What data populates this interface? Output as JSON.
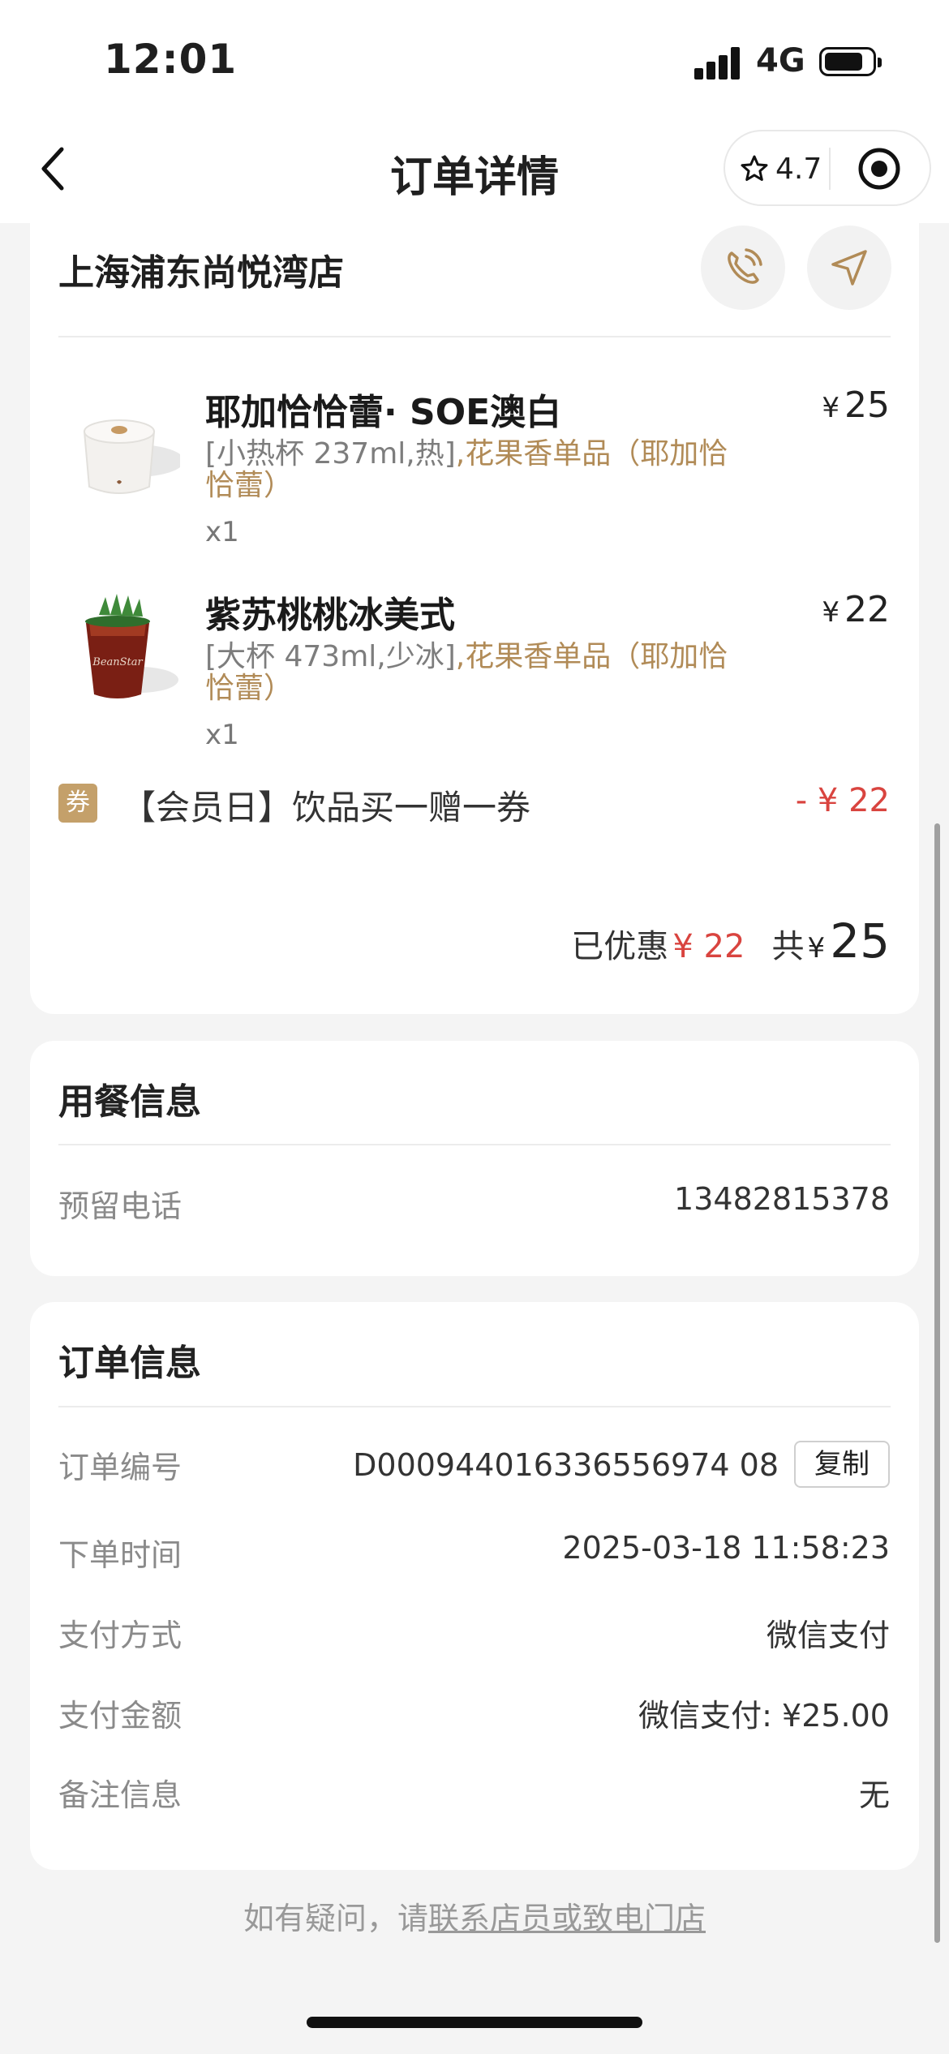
{
  "status": {
    "time": "12:01",
    "network": "4G"
  },
  "nav": {
    "title": "订单详情",
    "rating": "4.7"
  },
  "store": {
    "name": "上海浦东尚悦湾店"
  },
  "products": [
    {
      "name": "耶加恰恰蕾· SOE澳白",
      "spec": "[小热杯 237ml,热]",
      "spec_highlight": ",花果香单品（耶加恰恰蕾）",
      "qty": "x1",
      "currency": "¥",
      "price": "25"
    },
    {
      "name": "紫苏桃桃冰美式",
      "spec": "[大杯 473ml,少冰]",
      "spec_highlight": ",花果香单品（耶加恰恰蕾）",
      "qty": "x1",
      "currency": "¥",
      "price": "22"
    }
  ],
  "coupon": {
    "badge": "券",
    "text": "【会员日】饮品买一赠一券",
    "value": "- ¥ 22"
  },
  "summary": {
    "discount_label": "已优惠",
    "discount_value": "¥ 22",
    "total_label": "共",
    "currency": "¥",
    "total": "25"
  },
  "dining": {
    "title": "用餐信息",
    "phone_label": "预留电话",
    "phone": "13482815378"
  },
  "order": {
    "title": "订单信息",
    "id_label": "订单编号",
    "id": "D000944016336556974 08",
    "copy_label": "复制",
    "time_label": "下单时间",
    "time": "2025-03-18 11:58:23",
    "pay_method_label": "支付方式",
    "pay_method": "微信支付",
    "pay_amount_label": "支付金额",
    "pay_amount": "微信支付: ¥25.00",
    "note_label": "备注信息",
    "note": "无"
  },
  "footer": {
    "prefix": "如有疑问，请",
    "link": "联系店员或致电门店"
  }
}
